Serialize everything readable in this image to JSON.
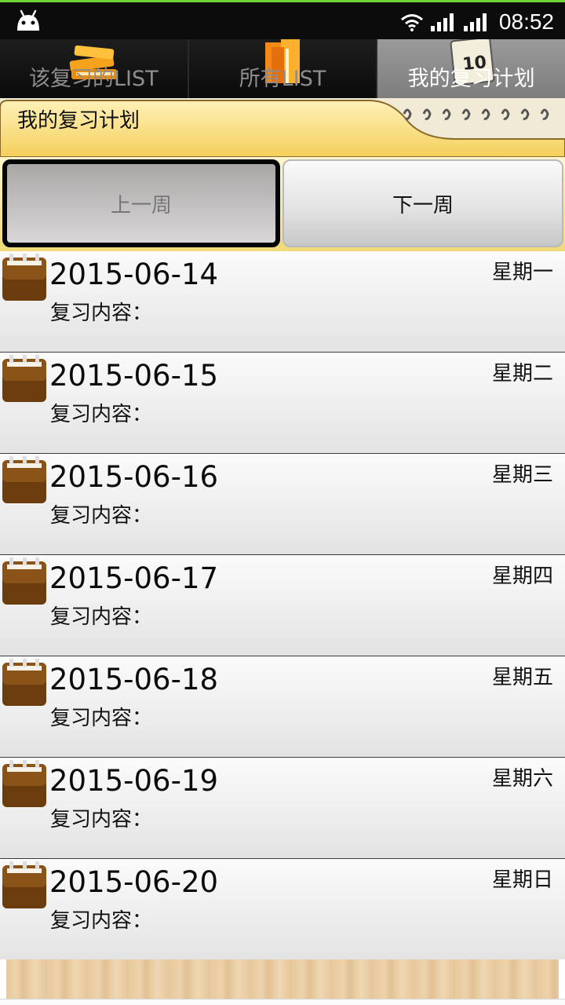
{
  "status_bar": {
    "time": "08:52"
  },
  "tabs": [
    {
      "label": "该复习的LIST",
      "active": false,
      "icon": "books-icon"
    },
    {
      "label": "所有LIST",
      "active": false,
      "icon": "book-stack-icon"
    },
    {
      "label": "我的复习计划",
      "active": true,
      "icon": "calendar-icon"
    }
  ],
  "header": {
    "title": "我的复习计划"
  },
  "week_nav": {
    "prev_label": "上一周",
    "next_label": "下一周"
  },
  "plan_items": [
    {
      "date": "2015-06-14",
      "weekday": "星期一",
      "content_label": "复习内容："
    },
    {
      "date": "2015-06-15",
      "weekday": "星期二",
      "content_label": "复习内容："
    },
    {
      "date": "2015-06-16",
      "weekday": "星期三",
      "content_label": "复习内容："
    },
    {
      "date": "2015-06-17",
      "weekday": "星期四",
      "content_label": "复习内容："
    },
    {
      "date": "2015-06-18",
      "weekday": "星期五",
      "content_label": "复习内容："
    },
    {
      "date": "2015-06-19",
      "weekday": "星期六",
      "content_label": "复习内容："
    },
    {
      "date": "2015-06-20",
      "weekday": "星期日",
      "content_label": "复习内容："
    }
  ],
  "colors": {
    "status_accent": "#6fd336",
    "header_yellow": "#f7d56a",
    "calendar_brown": "#6b3d0e"
  }
}
